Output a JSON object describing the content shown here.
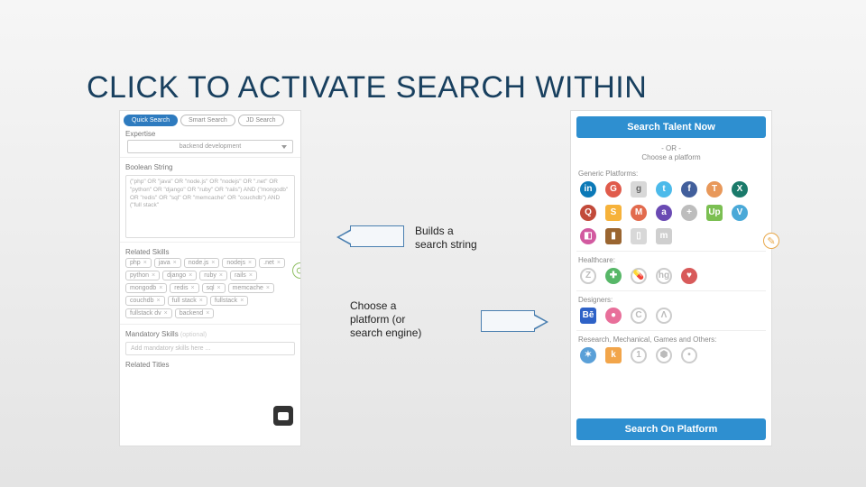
{
  "title": "CLICK TO ACTIVATE SEARCH WITHIN",
  "annotations": {
    "builds": "Builds a search string",
    "choose": "Choose a platform (or search engine)"
  },
  "left": {
    "tabs": [
      "Quick Search",
      "Smart Search",
      "JD Search"
    ],
    "expertise_label": "Expertise",
    "expertise_value": "backend development",
    "boolean_label": "Boolean String",
    "boolean_text": "(\"php\" OR \"java\" OR \"node.js\" OR \"nodejs\" OR \".net\" OR \"python\" OR \"django\" OR \"ruby\" OR \"rails\") AND (\"mongodb\" OR \"redis\" OR \"sql\" OR \"memcache\" OR \"couchdb\") AND (\"full stack\"",
    "related_label": "Related Skills",
    "related": [
      "php",
      "java",
      "node.js",
      "nodejs",
      ".net",
      "python",
      "django",
      "ruby",
      "rails",
      "mongodb",
      "redis",
      "sql",
      "memcache",
      "couchdb",
      "full stack",
      "fullstack",
      "fullstack dv",
      "backend"
    ],
    "mandatory_label": "Mandatory Skills",
    "mandatory_optional": "(optional)",
    "mandatory_placeholder": "Add mandatory skills here ...",
    "related_titles_label": "Related Titles"
  },
  "right": {
    "top_button": "Search Talent Now",
    "or": "- OR -",
    "choose": "Choose a platform",
    "cat_generic": "Generic Platforms:",
    "generic": [
      {
        "t": "in",
        "bg": "#0b79b7"
      },
      {
        "t": "G",
        "bg": "#e05b4b"
      },
      {
        "t": "g",
        "bg": "#d8d8d8",
        "fg": "#666",
        "sq": true
      },
      {
        "t": "t",
        "bg": "#4cbaea"
      },
      {
        "t": "f",
        "bg": "#425f9c"
      },
      {
        "t": "T",
        "bg": "#e8985a"
      },
      {
        "t": "X",
        "bg": "#1a7a6a"
      },
      {
        "t": "Q",
        "bg": "#c24a3a"
      },
      {
        "t": "S",
        "bg": "#f6b23a",
        "sq": true
      },
      {
        "t": "M",
        "bg": "#e26a4d"
      },
      {
        "t": "a",
        "bg": "#6a4ab3"
      },
      {
        "t": "+",
        "bg": "#bdbdbd"
      },
      {
        "t": "Up",
        "bg": "#7bbf52",
        "sq": true
      },
      {
        "t": "V",
        "bg": "#4aa9d8"
      },
      {
        "t": "◧",
        "bg": "#d25aa0"
      },
      {
        "t": "▮",
        "bg": "#9a6530",
        "sq": true
      },
      {
        "t": "▯",
        "bg": "#d8d8d8",
        "sq": true
      },
      {
        "t": "m",
        "bg": "#cfcfcf",
        "sq": true
      }
    ],
    "cat_health": "Healthcare:",
    "health": [
      {
        "t": "Z",
        "ring": true
      },
      {
        "t": "✚",
        "bg": "#57b768"
      },
      {
        "t": "💊",
        "ring": true
      },
      {
        "t": "hg",
        "ring": true
      },
      {
        "t": "♥",
        "bg": "#d85a5a"
      }
    ],
    "cat_design": "Designers:",
    "design": [
      {
        "t": "Bē",
        "bg": "#2e62c7",
        "sq": true
      },
      {
        "t": "●",
        "bg": "#e86f9a"
      },
      {
        "t": "C",
        "ring": true
      },
      {
        "t": "Λ",
        "ring": true
      }
    ],
    "cat_research": "Research, Mechanical, Games and Others:",
    "research": [
      {
        "t": "✶",
        "bg": "#5aa0d8"
      },
      {
        "t": "k",
        "bg": "#f2a54a",
        "sq": true
      },
      {
        "t": "1",
        "ring": true
      },
      {
        "t": "⬢",
        "ring": true
      },
      {
        "t": "•",
        "ring": true
      }
    ],
    "bottom_button": "Search On Platform"
  }
}
